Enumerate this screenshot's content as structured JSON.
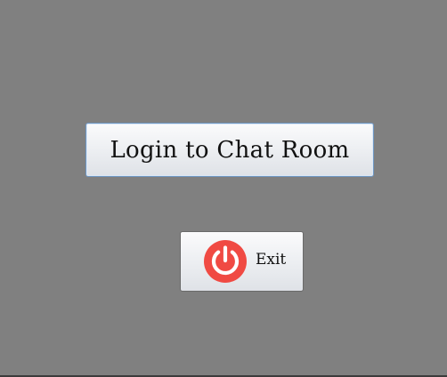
{
  "login": {
    "label": "Login to Chat Room"
  },
  "exit": {
    "label": "Exit",
    "icon": "power-icon"
  },
  "colors": {
    "background": "#808080",
    "power_icon": "#f04a43",
    "button_focus_border": "#6f96c2"
  }
}
